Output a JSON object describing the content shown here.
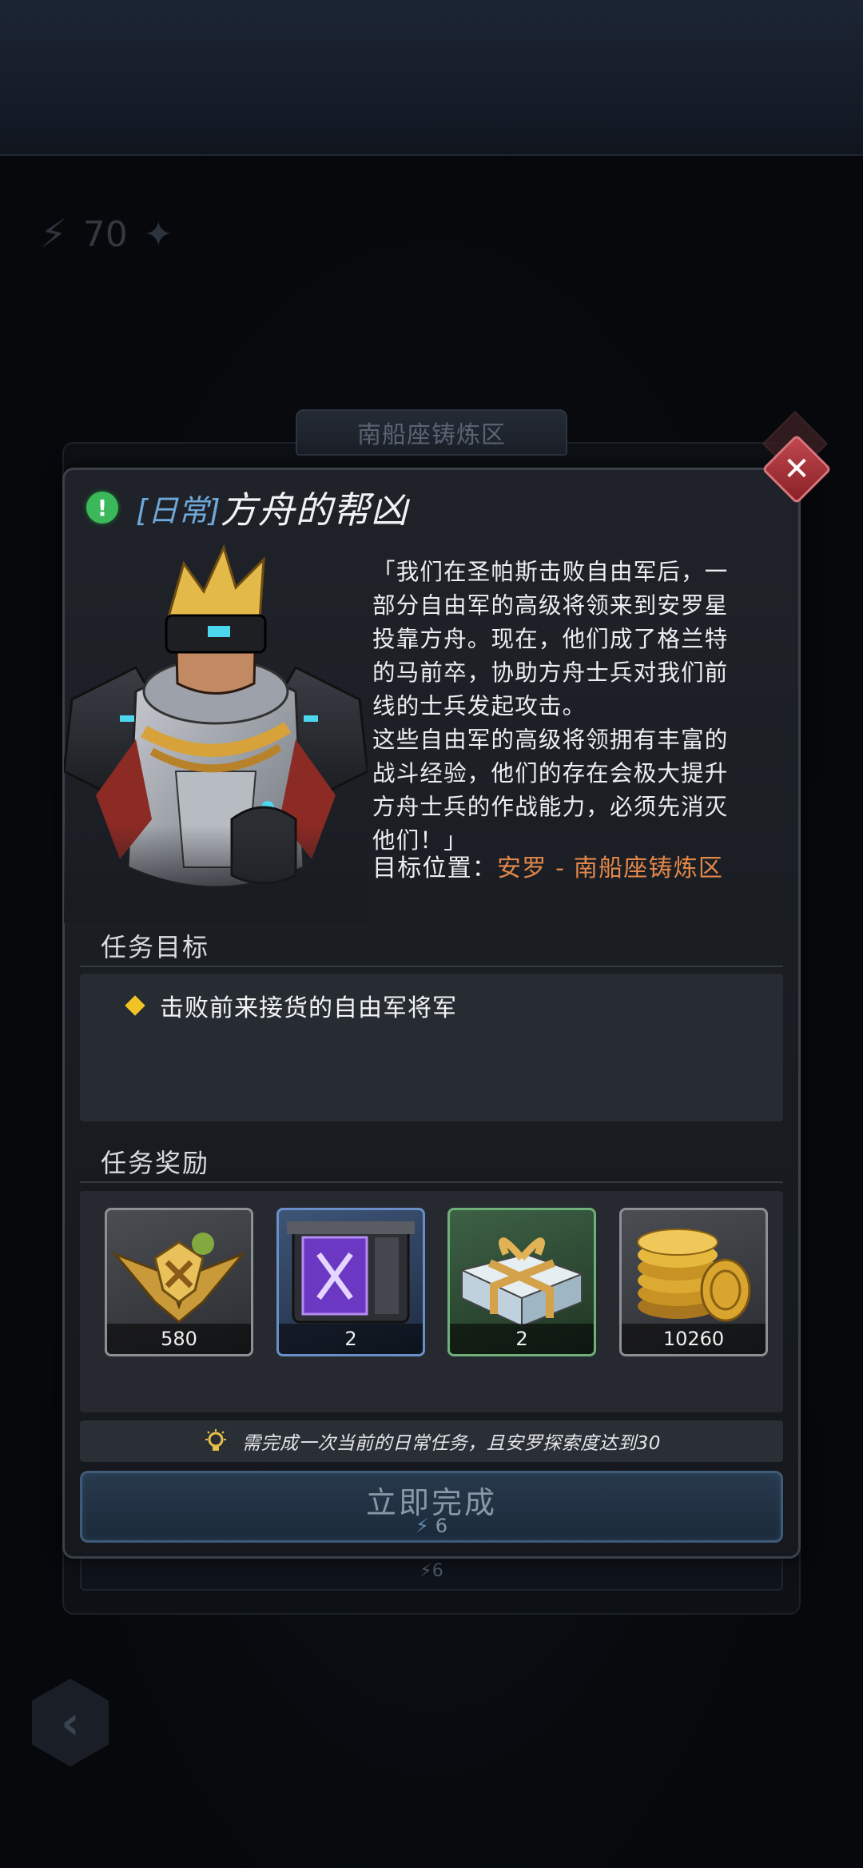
{
  "background": {
    "stat_value": "70",
    "area_tab": "南船座铸炼区",
    "bottom_cost": "6"
  },
  "dialog": {
    "title_tag": "[日常]",
    "title": "方舟的帮凶",
    "description": [
      "「我们在圣帕斯击败自由军后，一",
      "部分自由军的高级将领来到安罗星",
      "投靠方舟。现在，他们成了格兰特",
      "的马前卒，协助方舟士兵对我们前",
      "线的士兵发起攻击。",
      "这些自由军的高级将领拥有丰富的",
      "战斗经验，他们的存在会极大提升",
      "方舟士兵的作战能力，必须先消灭",
      "他们！」"
    ],
    "target_label": "目标位置：",
    "target_value": "安罗 - 南船座铸炼区",
    "objectives_header": "任务目标",
    "objectives": [
      "击败前来接货的自由军将军"
    ],
    "rewards_header": "任务奖励",
    "rewards": [
      {
        "icon": "gold-badge-icon",
        "count": "580",
        "rarity": "grey"
      },
      {
        "icon": "purple-crate-icon",
        "count": "2",
        "rarity": "blue"
      },
      {
        "icon": "gift-box-icon",
        "count": "2",
        "rarity": "green"
      },
      {
        "icon": "gold-coins-icon",
        "count": "10260",
        "rarity": "grey"
      }
    ],
    "hint": "需完成一次当前的日常任务，且安罗探索度达到30",
    "complete_label": "立即完成",
    "complete_cost": "6"
  },
  "colors": {
    "accent_orange": "#e2874a",
    "tag_blue": "#6fa7d8",
    "objective_diamond": "#f0c326",
    "alert_green": "#3bb85a",
    "close_red": "#b3353d"
  }
}
